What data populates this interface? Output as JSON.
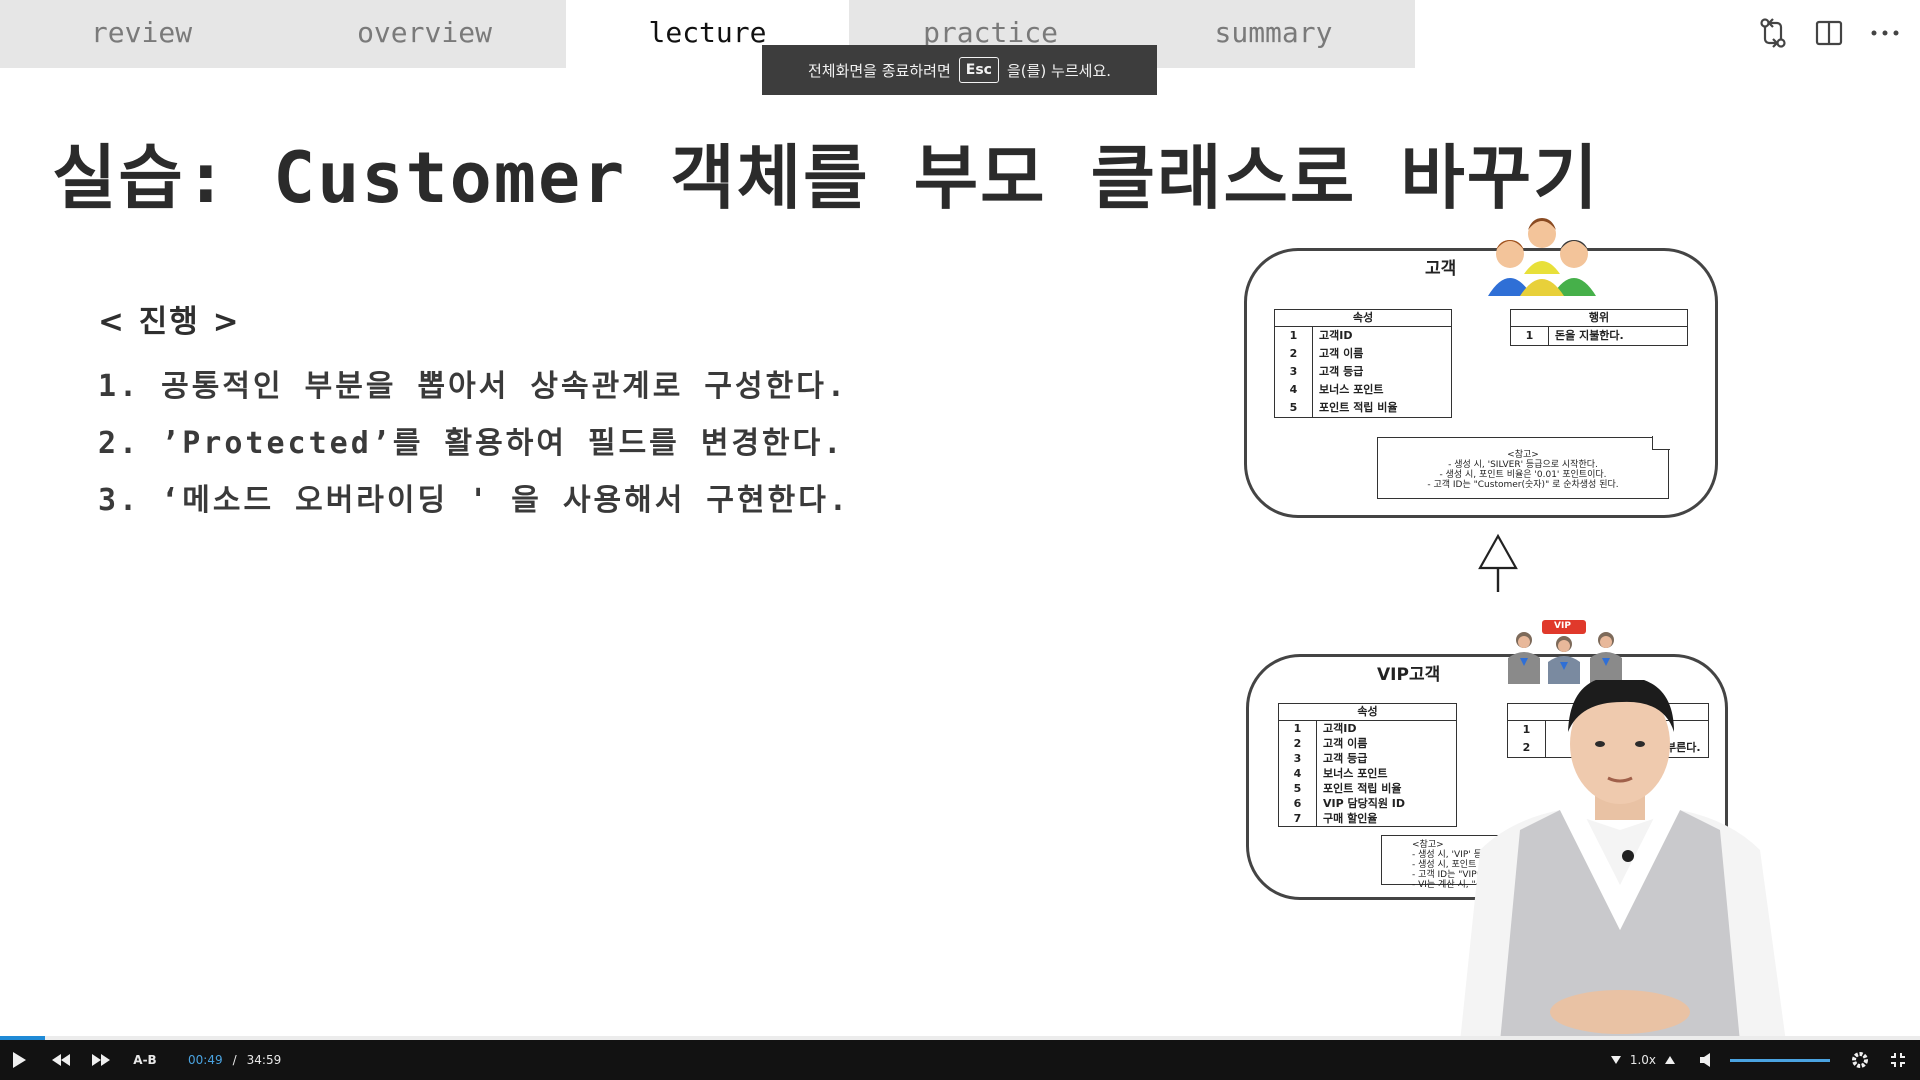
{
  "tabs": [
    {
      "label": "review",
      "active": false
    },
    {
      "label": "overview",
      "active": false
    },
    {
      "label": "lecture",
      "active": true
    },
    {
      "label": "practice",
      "active": false
    },
    {
      "label": "summary",
      "active": false
    }
  ],
  "toolbar": {
    "icons": [
      "compare-icon",
      "split-view-icon",
      "more-icon"
    ]
  },
  "toast": {
    "before_key": "전체화면을 종료하려면",
    "key": "Esc",
    "after_key": "을(를) 누르세요."
  },
  "slide": {
    "title": "실습: Customer 객체를 부모 클래스로 바꾸기",
    "heading": "< 진행 >",
    "steps": [
      "1. 공통적인 부분을 뽑아서 상속관계로 구성한다.",
      "2. ’Protected’를 활용하여 필드를 변경한다.",
      "3. ‘메소드 오버라이딩 ' 을 사용해서 구현한다."
    ]
  },
  "diagram": {
    "customer": {
      "title": "고객",
      "attr_header": "속성",
      "attrs": [
        {
          "no": "1",
          "name": "고객ID"
        },
        {
          "no": "2",
          "name": "고객 이름"
        },
        {
          "no": "3",
          "name": "고객 등급"
        },
        {
          "no": "4",
          "name": "보너스 포인트"
        },
        {
          "no": "5",
          "name": "포인트 적립 비율"
        }
      ],
      "behavior_header": "행위",
      "behaviors": [
        {
          "no": "1",
          "name": "돈을 지불한다."
        }
      ],
      "note_lines": [
        "<참고>",
        "- 생성 시, 'SILVER' 등급으로 시작한다.",
        "- 생성 시, 포인트 비율은 '0.01' 포인트이다.",
        "- 고객 ID는 \"Customer(숫자)\" 로 순차생성 된다."
      ]
    },
    "vip": {
      "title": "VIP고객",
      "badge": "VIP",
      "attr_header": "속성",
      "attrs": [
        {
          "no": "1",
          "name": "고객ID"
        },
        {
          "no": "2",
          "name": "고객 이름"
        },
        {
          "no": "3",
          "name": "고객 등급"
        },
        {
          "no": "4",
          "name": "보너스 포인트"
        },
        {
          "no": "5",
          "name": "포인트 적립 비율"
        },
        {
          "no": "6",
          "name": "VIP 담당직원 ID"
        },
        {
          "no": "7",
          "name": "구매 할인율"
        }
      ],
      "behaviors": [
        {
          "no": "1",
          "name": ""
        },
        {
          "no": "2",
          "name": "부른다."
        }
      ],
      "note_lines": [
        "<참고>",
        "- 생성 시, 'VIP' 등급으로",
        "- 생성 시, 포인트 비율은 '0",
        "- 고객 ID는 \"VIP(숫자",
        "- VI는 계산 시, \"구매"
      ]
    }
  },
  "player": {
    "progress_fraction": 0.0234,
    "ab_label": "A-B",
    "time_current": "00:49",
    "time_separator": "/",
    "time_total": "34:59",
    "speed": "1.0x",
    "volume_fraction": 1.0,
    "colors": {
      "accent": "#4aa3e0",
      "bar": "#121212"
    }
  }
}
